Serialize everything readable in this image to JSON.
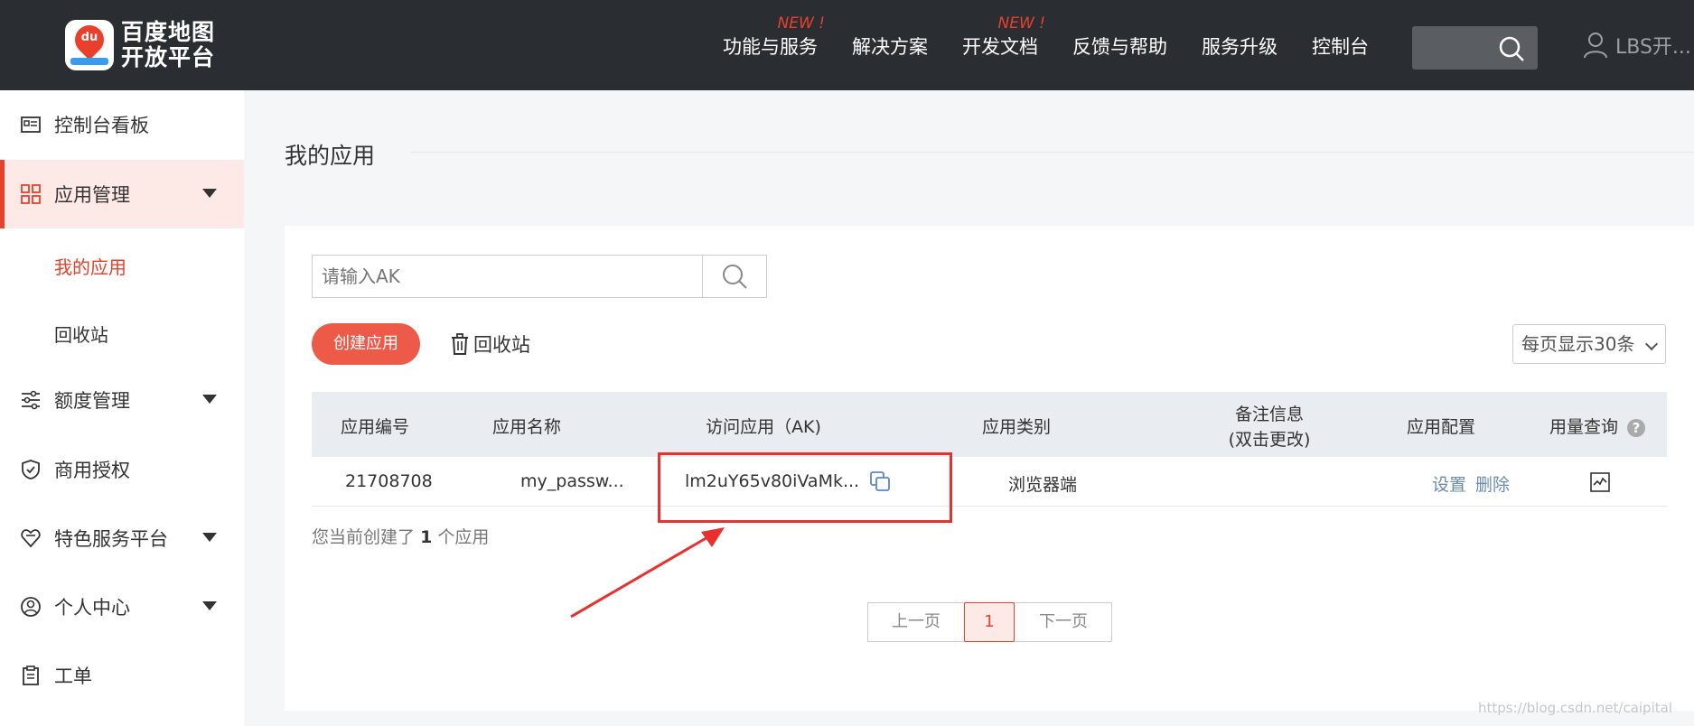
{
  "header": {
    "logo": {
      "mark": "du",
      "line1": "百度地图",
      "line2": "开放平台"
    },
    "nav": [
      {
        "label": "功能与服务",
        "badge": "NEW !"
      },
      {
        "label": "解决方案",
        "badge": ""
      },
      {
        "label": "开发文档",
        "badge": "NEW !"
      },
      {
        "label": "反馈与帮助",
        "badge": ""
      },
      {
        "label": "服务升级",
        "badge": ""
      },
      {
        "label": "控制台",
        "badge": ""
      }
    ],
    "user": "LBS开..."
  },
  "sidebar": {
    "items": [
      {
        "label": "控制台看板",
        "icon": "dashboard-icon"
      },
      {
        "label": "应用管理",
        "icon": "grid-icon"
      },
      {
        "label": "额度管理",
        "icon": "sliders-icon"
      },
      {
        "label": "商用授权",
        "icon": "shield-icon"
      },
      {
        "label": "特色服务平台",
        "icon": "heart-icon"
      },
      {
        "label": "个人中心",
        "icon": "user-icon"
      },
      {
        "label": "工单",
        "icon": "clipboard-icon"
      }
    ],
    "sub_items": [
      {
        "label": "我的应用"
      },
      {
        "label": "回收站"
      }
    ]
  },
  "main": {
    "title": "我的应用",
    "search_placeholder": "请输入AK",
    "create_label": "创建应用",
    "recycle_label": "回收站",
    "per_page": "每页显示30条",
    "columns": [
      "应用编号",
      "应用名称",
      "访问应用（AK)",
      "应用类别",
      "备注信息",
      "(双击更改)",
      "应用配置",
      "用量查询"
    ],
    "row": {
      "id": "21708708",
      "name": "my_passw...",
      "ak": "lm2uY65v80iVaMk...",
      "category": "浏览器端",
      "remark": "",
      "settings": "设置",
      "delete": "删除"
    },
    "summary_prefix": "您当前创建了",
    "summary_count": "1",
    "summary_suffix": "个应用",
    "pager": {
      "prev": "上一页",
      "current": "1",
      "next": "下一页"
    }
  },
  "watermark": "https://blog.csdn.net/caipital",
  "colors": {
    "accent": "#e8402b",
    "header_bg": "#2a2d31",
    "highlight": "#e8302e"
  }
}
